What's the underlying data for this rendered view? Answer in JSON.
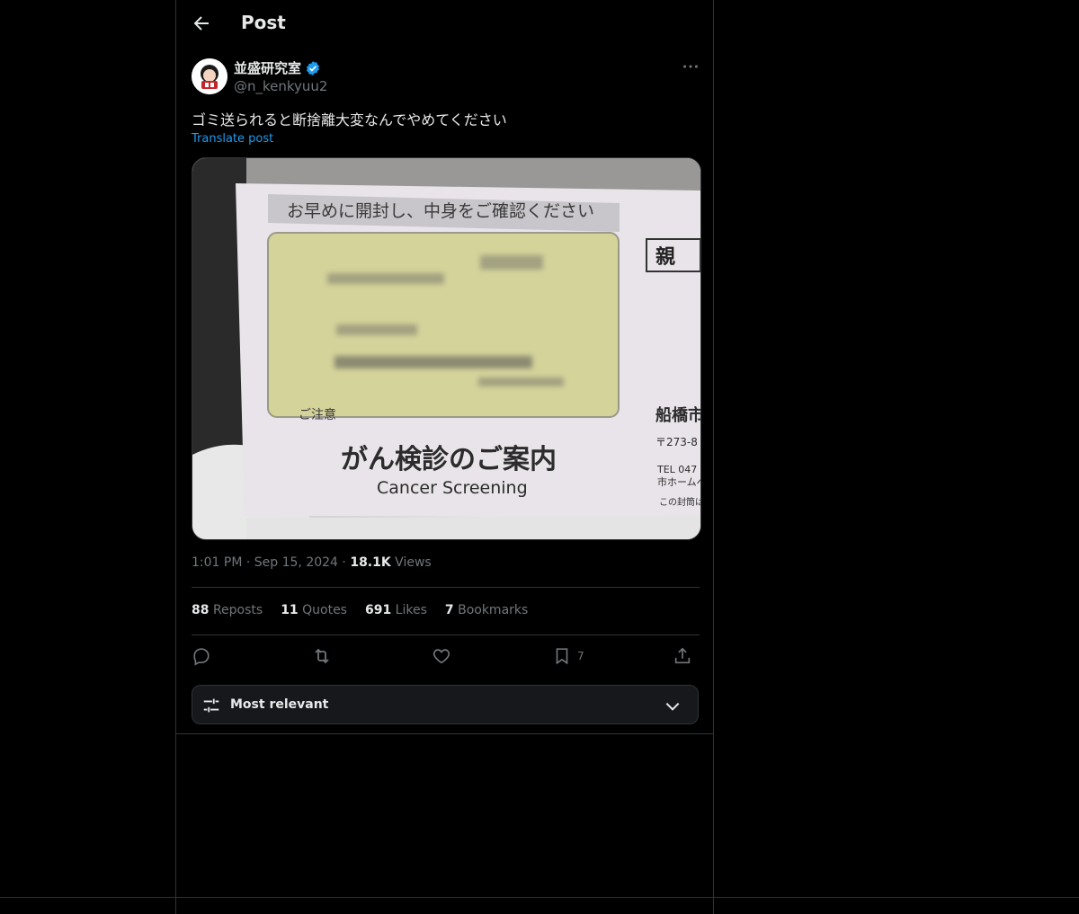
{
  "header": {
    "title": "Post"
  },
  "author": {
    "name": "並盛研究室",
    "handle": "@n_kenkyuu2",
    "verified": true
  },
  "post": {
    "text": "ゴミ送られると断捨離大変なんでやめてください",
    "translate_label": "Translate post",
    "image": {
      "banner_text": "お早めに開封し、中身をご確認ください",
      "main_text": "がん検診のご案内",
      "sub_text": "Cancer Screening",
      "side_label": "親",
      "side_city": "船橋市",
      "side_zip": "〒273-8",
      "side_tel": "TEL 047",
      "side_web": "市ホームペ",
      "side_note": "この封筒は",
      "window_note": "ご注意"
    }
  },
  "meta": {
    "time": "1:01 PM",
    "dot": "·",
    "date": "Sep 15, 2024",
    "views_count": "18.1K",
    "views_label": "Views"
  },
  "stats": {
    "reposts_count": "88",
    "reposts_label": "Reposts",
    "quotes_count": "11",
    "quotes_label": "Quotes",
    "likes_count": "691",
    "likes_label": "Likes",
    "bookmarks_count": "7",
    "bookmarks_label": "Bookmarks"
  },
  "actions": {
    "bookmark_count": "7"
  },
  "sort": {
    "label": "Most relevant"
  },
  "colors": {
    "accent": "#1d9bf0",
    "muted": "#71767b",
    "border": "#2f3336"
  }
}
